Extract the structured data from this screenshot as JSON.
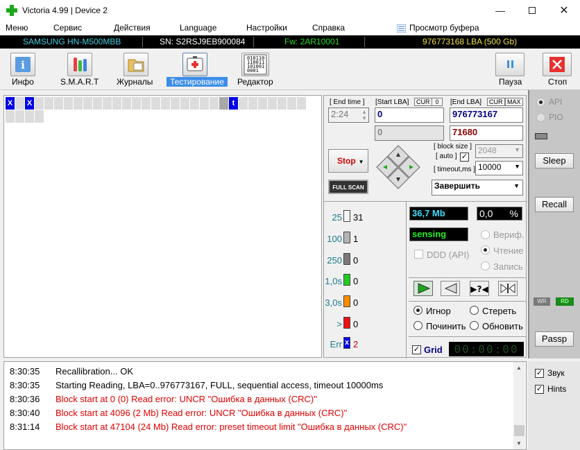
{
  "window": {
    "title": "Victoria 4.99 | Device 2"
  },
  "menu": [
    "Меню",
    "Сервис",
    "Действия",
    "Language",
    "Настройки",
    "Справка"
  ],
  "buffer_view": "Просмотр буфера",
  "info": {
    "model": "SAMSUNG HN-M500MBB",
    "serial": "SN: S2RSJ9EB900084",
    "firmware": "Fw: 2AR10001",
    "capacity": "976773168 LBA (500 Gb)"
  },
  "toolbar": [
    {
      "label": "Инфо"
    },
    {
      "label": "S.M.A.R.T"
    },
    {
      "label": "Журналы"
    },
    {
      "label": "Тестирование"
    },
    {
      "label": "Редактор"
    },
    {
      "label": "Пауза"
    },
    {
      "label": "Стоп"
    }
  ],
  "editor_icon_text": [
    "010110",
    "110011",
    "101001",
    "0001"
  ],
  "grid": {
    "marks": [
      "X",
      "X",
      "t"
    ]
  },
  "test": {
    "end_time_label": "[ End time ]",
    "end_time": "2:24",
    "start_lba_label": "[Start LBA]",
    "cur": "CUR",
    "zero_tag": "0",
    "end_lba_label": "[End LBA]",
    "max": "MAX",
    "start_lba": "0",
    "end_lba": "976773167",
    "current_lba": "0",
    "remaining": "71680",
    "stop_button": "Stop",
    "full_scan": "FULL SCAN",
    "block_size_label": "[ block size ]",
    "auto_label": "[ auto ]",
    "block_size": "2048",
    "timeout_label": "[ timeout,ms ]",
    "timeout": "10000",
    "finish": "Завершить"
  },
  "stats": [
    {
      "label": "25",
      "count": "31",
      "color": "#f4f4f4"
    },
    {
      "label": "100",
      "count": "1",
      "color": "#b4b4b4"
    },
    {
      "label": "250",
      "count": "0",
      "color": "#7a7a7a"
    },
    {
      "label": "1,0s",
      "count": "0",
      "color": "#22cc22"
    },
    {
      "label": "3,0s",
      "count": "0",
      "color": "#ff8c00"
    },
    {
      "label": ">",
      "count": "0",
      "color": "#ee1111"
    },
    {
      "label": "Err",
      "count": "2",
      "color": "#0000e6"
    }
  ],
  "err_mark": "x",
  "speed": "36,7 Mb",
  "percent": "0,0",
  "percent_unit": "%",
  "status": "sensing",
  "ddd": "DDD (API)",
  "modes": {
    "verify": "Вериф.",
    "read": "Чтение",
    "write": "Запись"
  },
  "actions": {
    "ignore": "Игнор",
    "erase": "Стереть",
    "repair": "Починить",
    "refresh": "Обновить"
  },
  "grid_label": "Grid",
  "timer": "00:00:00",
  "side": {
    "api": "API",
    "pio": "PIO",
    "sleep": "Sleep",
    "recall": "Recall",
    "wr": "WR",
    "rd": "RD",
    "passp": "Passp"
  },
  "log": [
    {
      "time": "8:30:35",
      "text": "Recallibration... OK",
      "color": "#000000"
    },
    {
      "time": "8:30:35",
      "text": "Starting Reading, LBA=0..976773167, FULL, sequential access, timeout 10000ms",
      "color": "#000000"
    },
    {
      "time": "8:30:36",
      "text": "Block start at 0 (0) Read error: UNCR \"Ошибка в данных (CRC)\"",
      "color": "#e00000"
    },
    {
      "time": "8:30:40",
      "text": "Block start at 4096 (2 Mb) Read error: UNCR \"Ошибка в данных (CRC)\"",
      "color": "#e00000"
    },
    {
      "time": "8:31:14",
      "text": "Block start at 47104 (24 Mb) Read error: preset timeout limit \"Ошибка в данных (CRC)\"",
      "color": "#e00000"
    }
  ],
  "options": {
    "sound": "Звук",
    "hints": "Hints"
  }
}
